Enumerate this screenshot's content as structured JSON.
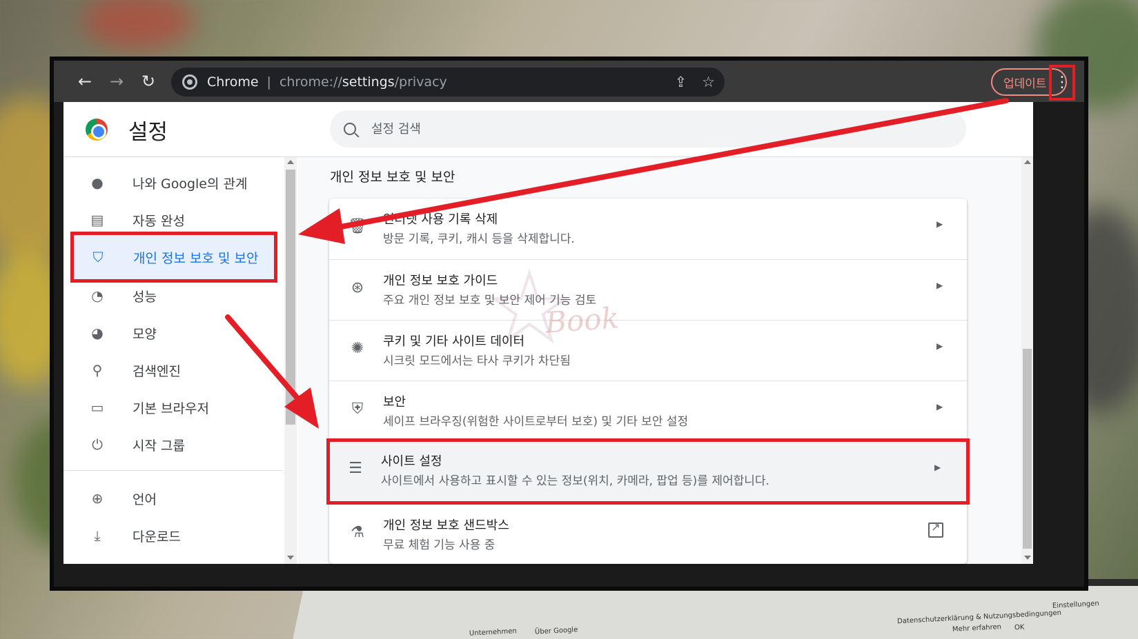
{
  "toolbar": {
    "omnibox_label": "Chrome",
    "url_prefix": "chrome://",
    "url_bold": "settings",
    "url_path": "/privacy",
    "update_label": "업데이트"
  },
  "header": {
    "title": "설정",
    "search_placeholder": "설정 검색"
  },
  "sidebar": {
    "items": [
      {
        "label": "나와 Google의 관계",
        "icon": "person-icon"
      },
      {
        "label": "자동 완성",
        "icon": "clipboard-icon"
      },
      {
        "label": "개인 정보 보호 및 보안",
        "icon": "shield-icon"
      },
      {
        "label": "성능",
        "icon": "speedometer-icon"
      },
      {
        "label": "모양",
        "icon": "palette-icon"
      },
      {
        "label": "검색엔진",
        "icon": "search-icon"
      },
      {
        "label": "기본 브라우저",
        "icon": "browser-icon"
      },
      {
        "label": "시작 그룹",
        "icon": "power-icon"
      },
      {
        "label": "언어",
        "icon": "globe-icon"
      },
      {
        "label": "다운로드",
        "icon": "download-icon"
      }
    ]
  },
  "main": {
    "section_title": "개인 정보 보호 및 보안",
    "rows": [
      {
        "title": "인터넷 사용 기록 삭제",
        "subtitle": "방문 기록, 쿠키, 캐시 등을 삭제합니다.",
        "icon": "trash-icon"
      },
      {
        "title": "개인 정보 보호 가이드",
        "subtitle": "주요 개인 정보 보호 및 보안 제어 기능 검토",
        "icon": "compass-icon"
      },
      {
        "title": "쿠키 및 기타 사이트 데이터",
        "subtitle": "시크릿 모드에서는 타사 쿠키가 차단됨",
        "icon": "cookie-icon"
      },
      {
        "title": "보안",
        "subtitle": "세이프 브라우징(위험한 사이트로부터 보호) 및 기타 보안 설정",
        "icon": "security-shield-icon"
      },
      {
        "title": "사이트 설정",
        "subtitle": "사이트에서 사용하고 표시할 수 있는 정보(위치, 카메라, 팝업 등)를 제어합니다.",
        "icon": "sliders-icon"
      },
      {
        "title": "개인 정보 보호 샌드박스",
        "subtitle": "무료 체험 기능 사용 중",
        "icon": "flask-icon"
      }
    ]
  },
  "watermark": "Book",
  "laptop_texts": {
    "t1": "Datenschutzerklärung & Nutzungsbedingungen",
    "t2": "Einstellungen",
    "t3": "Unternehmen",
    "t4": "Über Google",
    "t5": "Mehr erfahren",
    "t6": "OK"
  },
  "colors": {
    "accent_blue": "#1a73e8",
    "annotation_red": "#e41e26",
    "toolbar_dark": "#3a3a3b",
    "update_pink": "#f28b82"
  }
}
